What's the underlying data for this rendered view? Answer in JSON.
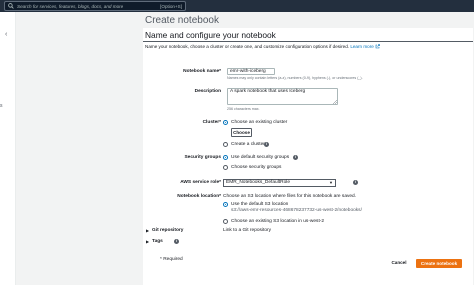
{
  "topbar": {
    "search_placeholder": "Search for services, features, blogs, docs, and more",
    "shortcut": "[Option+S]"
  },
  "page": {
    "title": "Create notebook"
  },
  "section": {
    "title": "Name and configure your notebook",
    "description": "Name your notebook, choose a cluster or create one, and customize configuration options if desired.",
    "learn_more": "Learn more"
  },
  "fields": {
    "notebook_name": {
      "label": "Notebook name*",
      "value": "emr-with-iceberg",
      "hint": "Names may only contain letters (a-z), numbers (0-9), hyphens (-), or underscores (_)."
    },
    "description": {
      "label": "Description",
      "value": "A spark notebook that uses Iceberg",
      "hint": "256 characters max."
    },
    "cluster": {
      "label": "Cluster*",
      "option_existing": "Choose an existing cluster",
      "choose_button": "Choose",
      "option_create": "Create a cluster"
    },
    "security_groups": {
      "label": "Security groups",
      "option_default": "Use default security groups",
      "option_choose": "Choose security groups"
    },
    "service_role": {
      "label": "AWS service role*",
      "value": "EMR_Notebooks_DefaultRole"
    },
    "notebook_location": {
      "label": "Notebook location*",
      "intro": "Choose an S3 location where files for this notebook are saved.",
      "option_default": "Use the default S3 location",
      "default_path": "s3://aws-emr-resources-468678237732-us-west-2/notebooks/",
      "option_existing": "Choose an existing S3 location in us-west-2"
    },
    "git": {
      "label": "Git repository",
      "value": "Link to a Git repository"
    },
    "tags": {
      "label": "Tags"
    }
  },
  "footer": {
    "required_note": "* Required",
    "cancel": "Cancel",
    "create": "Create notebook"
  },
  "colors": {
    "accent": "#0073bb",
    "primary_button": "#ec7211",
    "topbar": "#232f3e"
  }
}
